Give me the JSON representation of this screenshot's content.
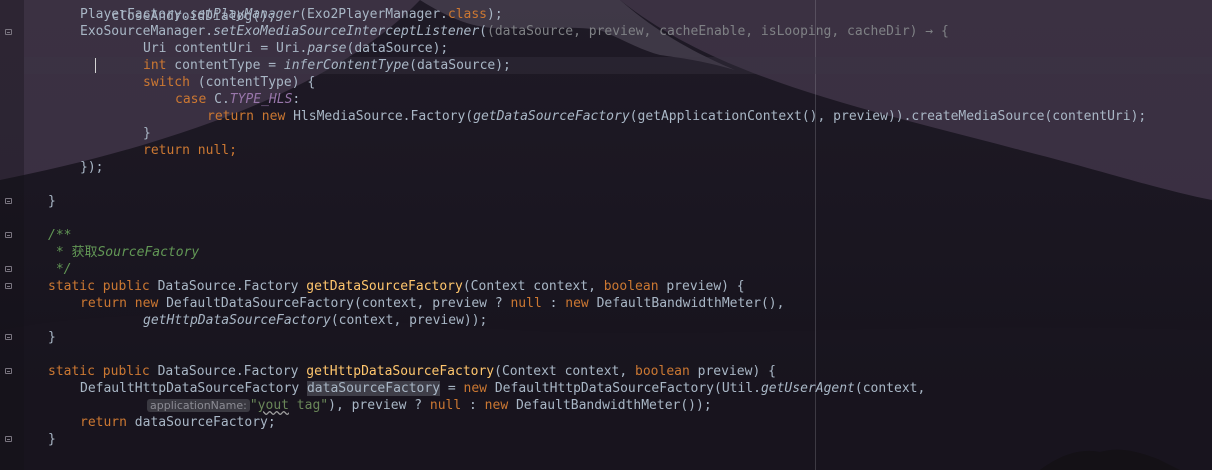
{
  "editor": {
    "lines": [
      {
        "t": "closeAndroidDialog();"
      },
      {
        "a": "PlayerFactory.",
        "b": "setPlayManager",
        "c": "(Exo2PlayerManager.",
        "d": "class",
        "e": ");"
      },
      {
        "a": "ExoSourceManager.",
        "b": "setExoMediaSourceInterceptListener",
        "c": "(",
        "d": "(dataSource, preview, cacheEnable, isLooping, cacheDir) → {"
      },
      {
        "a": "Uri contentUri = Uri.",
        "b": "parse",
        "c": "(dataSource);"
      },
      {
        "a": "int",
        "b": " contentType = ",
        "c": "inferContentType",
        "d": "(dataSource);"
      },
      {
        "a": "switch",
        "b": " (contentType) {"
      },
      {
        "a": "case",
        "b": " C.",
        "c": "TYPE_HLS",
        "d": ":"
      },
      {
        "a": "return new",
        "b": " HlsMediaSource.Factory(",
        "c": "getDataSourceFactory",
        "d": "(getApplicationContext(), preview)).createMediaSource(contentUri);"
      },
      {
        "t": "}"
      },
      {
        "a": "return null",
        "b": ";"
      },
      {
        "t": "});"
      },
      {
        "t": "}"
      },
      {
        "t": "/**"
      },
      {
        "a": " * 获取",
        "b": "SourceFactory"
      },
      {
        "t": " */"
      },
      {
        "a": "static public",
        "b": " DataSource.Factory ",
        "c": "getDataSourceFactory",
        "d": "(Context context, ",
        "e": "boolean",
        "f": " preview) {"
      },
      {
        "a": "return new",
        "b": " DefaultDataSourceFactory(context, preview ? ",
        "c": "null",
        "d": " : ",
        "e": "new",
        "f": " DefaultBandwidthMeter(),"
      },
      {
        "a": "getHttpDataSourceFactory",
        "b": "(context, preview));"
      },
      {
        "t": "}"
      },
      {
        "a": "static public",
        "b": " DataSource.Factory ",
        "c": "getHttpDataSourceFactory",
        "d": "(Context context, ",
        "e": "boolean",
        "f": " preview) {"
      },
      {
        "a": "DefaultHttpDataSourceFactory ",
        "b": "dataSourceFactory",
        "c": " = ",
        "d": "new",
        "e": " DefaultHttpDataSourceFactory(Util.",
        "f": "getUserAgent",
        "g": "(context,"
      },
      {
        "hint": "applicationName:",
        "a": "\"",
        "b": "yout",
        "c": " tag\"",
        "d": "), preview ? ",
        "e": "null",
        "f": " : ",
        "g": "new",
        "h": " DefaultBandwidthMeter());"
      },
      {
        "a": "return",
        "b": " dataSourceFactory;"
      },
      {
        "t": "}"
      }
    ]
  }
}
